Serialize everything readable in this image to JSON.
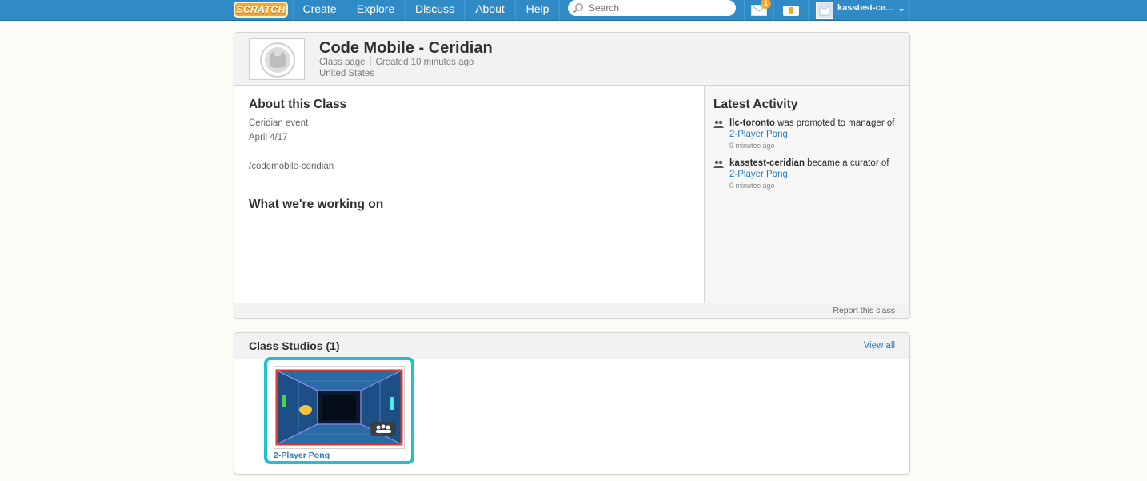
{
  "nav": {
    "logo": "SCRATCH",
    "links": [
      "Create",
      "Explore",
      "Discuss",
      "About",
      "Help"
    ],
    "search_placeholder": "Search",
    "messages_count": "1",
    "username": "kasstest-ce..."
  },
  "class": {
    "title": "Code Mobile - Ceridian",
    "type": "Class page",
    "created": "Created 10 minutes ago",
    "country": "United States"
  },
  "about": {
    "heading": "About this Class",
    "lines": [
      "Ceridian event",
      "April 4/17",
      "/codemobile-ceridian"
    ],
    "working_heading": "What we're working on"
  },
  "activity": {
    "heading": "Latest Activity",
    "items": [
      {
        "user": "llc-toronto",
        "action": "was promoted to manager of",
        "target": "2-Player Pong",
        "time": "9 minutes ago"
      },
      {
        "user": "kasstest-ceridian",
        "action": "became a curator of",
        "target": "2-Player Pong",
        "time": "0 minutes ago"
      }
    ]
  },
  "footer": {
    "report": "Report this class"
  },
  "studios": {
    "heading": "Class Studios (1)",
    "view_all": "View all",
    "items": [
      {
        "title": "2-Player Pong"
      }
    ]
  },
  "colors": {
    "nav": "#2f8ac6",
    "link": "#2a7ab8",
    "highlight": "#1fc0d4",
    "logo": "#f7a631"
  }
}
